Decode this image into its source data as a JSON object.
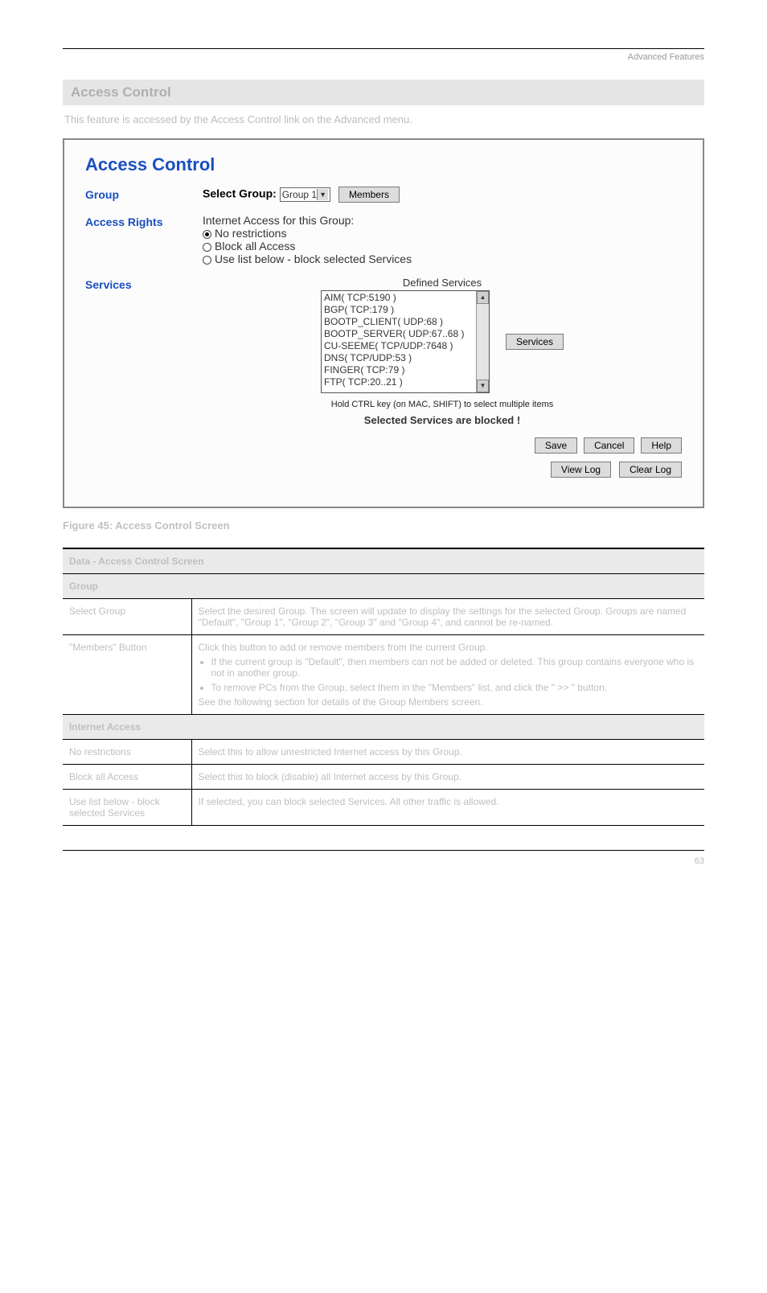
{
  "header": {
    "right": "Advanced Features"
  },
  "band": {
    "title": "Access Control"
  },
  "pretext": "This feature is accessed by the Access Control link on the Advanced menu.",
  "screenshot": {
    "title": "Access Control",
    "group": {
      "label": "Group",
      "select_label": "Select Group:",
      "selected": "Group 1",
      "members_btn": "Members"
    },
    "access_rights": {
      "label": "Access Rights",
      "intro": "Internet Access for this Group:",
      "opt1": "No restrictions",
      "opt2": "Block all Access",
      "opt3": "Use list below - block selected Services"
    },
    "services": {
      "label": "Services",
      "defined_label": "Defined Services",
      "items": [
        "AIM( TCP:5190 )",
        "BGP( TCP:179 )",
        "BOOTP_CLIENT( UDP:68 )",
        "BOOTP_SERVER( UDP:67..68 )",
        "CU-SEEME( TCP/UDP:7648 )",
        "DNS( TCP/UDP:53 )",
        "FINGER( TCP:79 )",
        "FTP( TCP:20..21 )"
      ],
      "services_btn": "Services",
      "hint": "Hold CTRL key (on MAC, SHIFT) to select multiple items",
      "blocked_msg": "Selected Services are blocked !"
    },
    "buttons": {
      "save": "Save",
      "cancel": "Cancel",
      "help": "Help",
      "view_log": "View Log",
      "clear_log": "Clear Log"
    }
  },
  "fig_caption": "Figure 45: Access Control Screen",
  "table": {
    "header": "Data - Access Control Screen",
    "section1": "Group",
    "r1c1": "Select Group",
    "r1c2": "Select the desired Group. The screen will update to display the settings for the selected Group. Groups are named \"Default\", \"Group 1\", \"Group 2\", \"Group 3\" and \"Group 4\", and cannot be re-named.",
    "r2c1": "\"Members\" Button",
    "r2c2_intro": "Click this button to add or remove members from the current Group.",
    "r2c2_b1": "If the current group is \"Default\", then members can not be added or deleted. This group contains everyone who is not in another group.",
    "r2c2_b2": "To remove PCs from the Group, select them in the \"Members\" list, and click the \" >> \" button.",
    "r2c2_see": "See the following section for details of the Group Members screen.",
    "section2": "Internet Access",
    "r3c1": "No restrictions",
    "r3c2": "Select this to allow unrestricted Internet access by this Group.",
    "r4c1": "Block all Access",
    "r4c2": "Select this to block (disable) all Internet access by this Group.",
    "r5c1": "Use list below - block selected Services",
    "r5c2": "If selected, you can block selected Services. All other traffic is allowed."
  },
  "footer": {
    "page": "63"
  }
}
